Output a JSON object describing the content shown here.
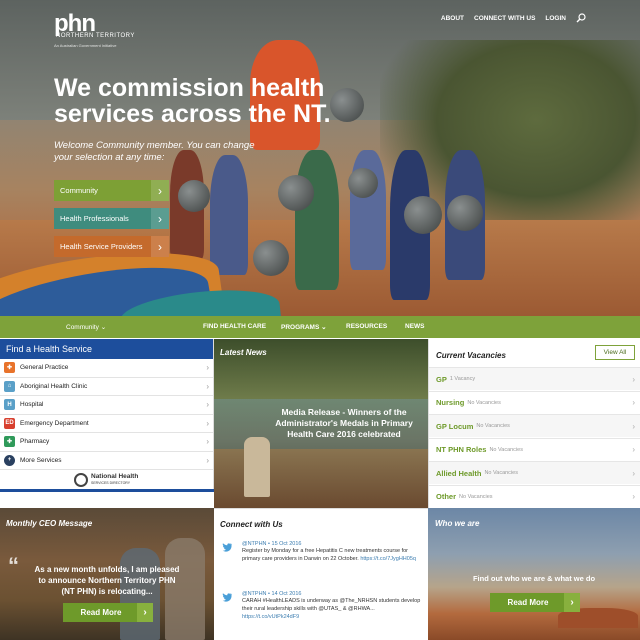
{
  "header": {
    "logo_mark": "phn",
    "logo_sub": "NORTHERN TERRITORY",
    "logo_gov": "An Australian Government Initiative",
    "nav": [
      "ABOUT",
      "CONNECT WITH US",
      "LOGIN"
    ]
  },
  "hero": {
    "headline": "We commission health services across the NT.",
    "welcome": "Welcome Community member. You can change your selection at any time:",
    "buttons": [
      "Community",
      "Health Professionals",
      "Health Service Providers"
    ]
  },
  "mainnav": {
    "community": "Community",
    "items": [
      "FIND HEALTH CARE",
      "PROGRAMS",
      "RESOURCES",
      "NEWS"
    ]
  },
  "find_service": {
    "title": "Find a Health Service",
    "items": [
      {
        "label": "General Practice",
        "icon": "stethoscope-icon",
        "color": "#e8732b",
        "glyph": "✚"
      },
      {
        "label": "Aboriginal Health Clinic",
        "icon": "clinic-icon",
        "color": "#5aa0c8",
        "glyph": "⌂"
      },
      {
        "label": "Hospital",
        "icon": "hospital-icon",
        "color": "#5aa0c8",
        "glyph": "H"
      },
      {
        "label": "Emergency Department",
        "icon": "emergency-icon",
        "color": "#d8402f",
        "glyph": "ED"
      },
      {
        "label": "Pharmacy",
        "icon": "pharmacy-icon",
        "color": "#2f9a5a",
        "glyph": "✚"
      },
      {
        "label": "More Services",
        "icon": "plus-icon",
        "color": "#2a4060",
        "glyph": "+"
      }
    ],
    "directory_name": "National Health",
    "directory_sub": "SERVICES DIRECTORY"
  },
  "latest_news": {
    "title": "Latest News",
    "caption": "Media Release - Winners of the Administrator's Medals in Primary Health Care 2016 celebrated"
  },
  "vacancies": {
    "title": "Current Vacancies",
    "view_all": "View All",
    "items": [
      {
        "role": "GP",
        "count": "1 Vacancy"
      },
      {
        "role": "Nursing",
        "count": "No Vacancies"
      },
      {
        "role": "GP Locum",
        "count": "No Vacancies"
      },
      {
        "role": "NT PHN Roles",
        "count": "No Vacancies"
      },
      {
        "role": "Allied Health",
        "count": "No Vacancies"
      },
      {
        "role": "Other",
        "count": "No Vacancies"
      }
    ]
  },
  "ceo": {
    "title": "Monthly CEO Message",
    "quote_mark": "“",
    "text": "As a new month unfolds, I am pleased to announce Northern Territory PHN (NT PHN) is relocating...",
    "button": "Read More"
  },
  "connect": {
    "title": "Connect with Us",
    "tweets": [
      {
        "meta": "@NTPHN • 15 Oct 2016",
        "body": "Register by Monday for a free Hepatitis C new treatments course for primary care providers in Darwin on 22 October.",
        "link": "https://t.co/7JygHH05q"
      },
      {
        "meta": "@NTPHN • 14 Oct 2016",
        "body": "CARAH #HealthLEADS is underway as @The_NRHSN students develop their rural leadership skills with @UTAS_ & @RHWA...",
        "link": "https://t.co/vUtPk24dF9"
      }
    ]
  },
  "who": {
    "title": "Who we are",
    "text": "Find out who we are & what we do",
    "button": "Read More"
  }
}
